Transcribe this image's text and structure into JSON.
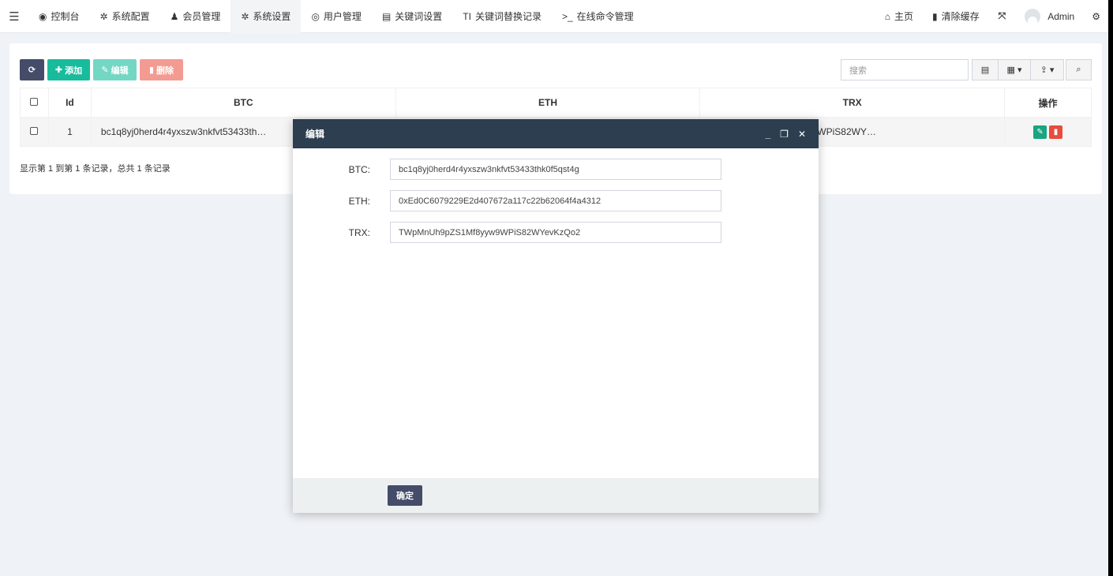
{
  "nav": {
    "items": [
      {
        "icon": "dashboard-icon",
        "glyph": "◉",
        "label": "控制台"
      },
      {
        "icon": "gear-icon",
        "glyph": "✲",
        "label": "系统配置"
      },
      {
        "icon": "user-icon",
        "glyph": "♟",
        "label": "会员管理"
      },
      {
        "icon": "gear-icon",
        "glyph": "✲",
        "label": "系统设置"
      },
      {
        "icon": "user-circle-icon",
        "glyph": "◎",
        "label": "用户管理"
      },
      {
        "icon": "file-icon",
        "glyph": "▤",
        "label": "关键词设置"
      },
      {
        "icon": "text-icon",
        "glyph": "TI",
        "label": "关键词替换记录"
      },
      {
        "icon": "terminal-icon",
        "glyph": ">_",
        "label": "在线命令管理"
      }
    ],
    "active_index": 3,
    "home_label": "主页",
    "clear_cache_label": "清除缓存",
    "user_name": "Admin"
  },
  "toolbar": {
    "add_label": "添加",
    "edit_label": "编辑",
    "delete_label": "删除",
    "search_placeholder": "搜索"
  },
  "table": {
    "columns": [
      "Id",
      "BTC",
      "ETH",
      "TRX",
      "操作"
    ],
    "rows": [
      {
        "id": "1",
        "btc": "bc1q8yj0herd4r4yxszw3nkfvt53433th…",
        "eth": "",
        "trx": "WPiS82WY…"
      }
    ],
    "pager_text": "显示第 1 到第 1 条记录，总共 1 条记录"
  },
  "modal": {
    "title": "编辑",
    "fields": [
      {
        "label": "BTC:",
        "value": "bc1q8yj0herd4r4yxszw3nkfvt53433thk0f5qst4g"
      },
      {
        "label": "ETH:",
        "value": "0xEd0C6079229E2d407672a117c22b62064f4a4312"
      },
      {
        "label": "TRX:",
        "value": "TWpMnUh9pZS1Mf8yyw9WPiS82WYevKzQo2"
      }
    ],
    "confirm_label": "确定"
  },
  "colors": {
    "primary": "#444c69",
    "success": "#18bc9c",
    "danger": "#e74c3c",
    "modal_header": "#2c3e50"
  }
}
